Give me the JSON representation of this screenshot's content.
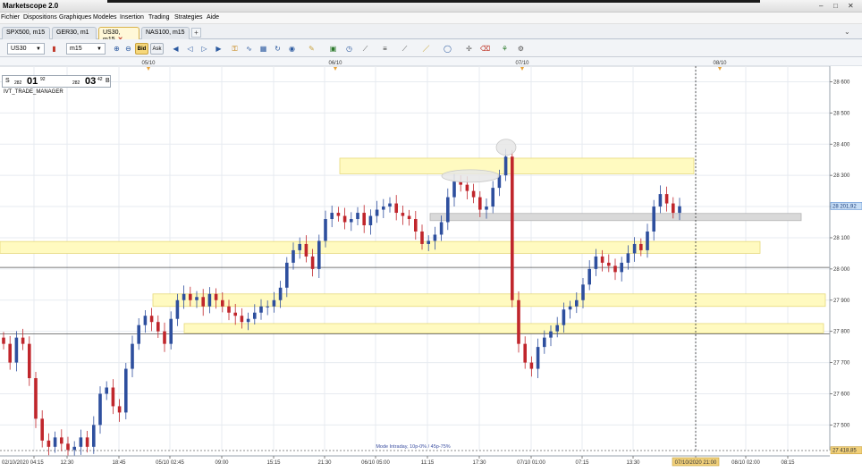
{
  "app": {
    "title": "Marketscope 2.0"
  },
  "window_controls": [
    "–",
    "□",
    "✕"
  ],
  "menu": [
    "Fichier",
    "Dispositions",
    "Graphiques",
    "Modeles",
    "Insertion",
    "Trading",
    "Strategies",
    "Aide"
  ],
  "tabs": [
    {
      "label": "SPX500, m15",
      "active": false
    },
    {
      "label": "GER30, m1",
      "active": false
    },
    {
      "label": "US30, m15",
      "active": true
    },
    {
      "label": "NAS100, m15",
      "active": false
    }
  ],
  "toolbar": {
    "instrument": "US30",
    "timeframe": "m15",
    "bid_label": "Bid",
    "ask_label": "Ask"
  },
  "quote": {
    "sell_label": "S",
    "sell_big": "282",
    "sell_main": "01",
    "sell_sup": "92",
    "buy_big": "282",
    "buy_main": "03",
    "buy_sup": "42",
    "buy_label": "B"
  },
  "indicator": "IVT_TRADE_MANAGER",
  "footer_note": "Mode Intraday, 10p-0% / 45p-75%",
  "chart_data": {
    "type": "candlestick",
    "ylim": [
      27418,
      28650
    ],
    "y_ticks": [
      28600,
      28500,
      28400,
      28300,
      28200,
      28100,
      28000,
      27900,
      27800,
      27700,
      27600,
      27500
    ],
    "y_tick_labels": [
      "28 600",
      "28 500",
      "28 400",
      "28 300",
      "28 200",
      "28 100",
      "28 000",
      "27 900",
      "27 800",
      "27 700",
      "27 600",
      "27 500"
    ],
    "x_labels": [
      "02/10/2020 04:15",
      "12:30",
      "18:45",
      "05/10 02:45",
      "09:00",
      "15:15",
      "21:30",
      "06/10 05:00",
      "11:15",
      "17:30",
      "07/10 01:00",
      "07:15",
      "13:30",
      "07/10/2020 21:00",
      "08/10 02:00",
      "08:15"
    ],
    "day_markers": [
      "05/10",
      "06/10",
      "07/10",
      "08/10"
    ],
    "current_price_label": "28 201,92",
    "bottom_price_label": "27 418,85",
    "cursor_time_label": "07/10/2020 21:00",
    "zones": [
      {
        "color": "yellow",
        "low": 28305,
        "high": 28355
      },
      {
        "color": "yellow",
        "low": 28050,
        "high": 28088
      },
      {
        "color": "yellow",
        "low": 27880,
        "high": 27920
      },
      {
        "color": "yellow",
        "low": 27795,
        "high": 27825
      },
      {
        "color": "gray",
        "low": 28155,
        "high": 28178
      }
    ],
    "h_lines": [
      28005,
      27792,
      27418
    ],
    "closes": [
      27760,
      27700,
      27780,
      27760,
      27650,
      27520,
      27450,
      27430,
      27460,
      27440,
      27420,
      27430,
      27460,
      27430,
      27500,
      27600,
      27620,
      27560,
      27540,
      27680,
      27760,
      27820,
      27850,
      27830,
      27800,
      27760,
      27840,
      27900,
      27920,
      27900,
      27910,
      27880,
      27920,
      27900,
      27880,
      27860,
      27850,
      27830,
      27840,
      27860,
      27880,
      27880,
      27900,
      27940,
      28020,
      28060,
      28080,
      28040,
      28000,
      28090,
      28160,
      28180,
      28170,
      28150,
      28160,
      28180,
      28140,
      28170,
      28190,
      28200,
      28210,
      28180,
      28170,
      28160,
      28120,
      28080,
      28090,
      28110,
      28150,
      28230,
      28280,
      28270,
      28250,
      28230,
      28190,
      28200,
      28260,
      28300,
      28360,
      27900,
      27760,
      27700,
      27680,
      27750,
      27780,
      27800,
      27820,
      27870,
      27880,
      27900,
      27950,
      28000,
      28040,
      28020,
      28010,
      27990,
      28020,
      28050,
      28080,
      28060,
      28120,
      28200,
      28240,
      28210,
      28180,
      28201
    ]
  }
}
